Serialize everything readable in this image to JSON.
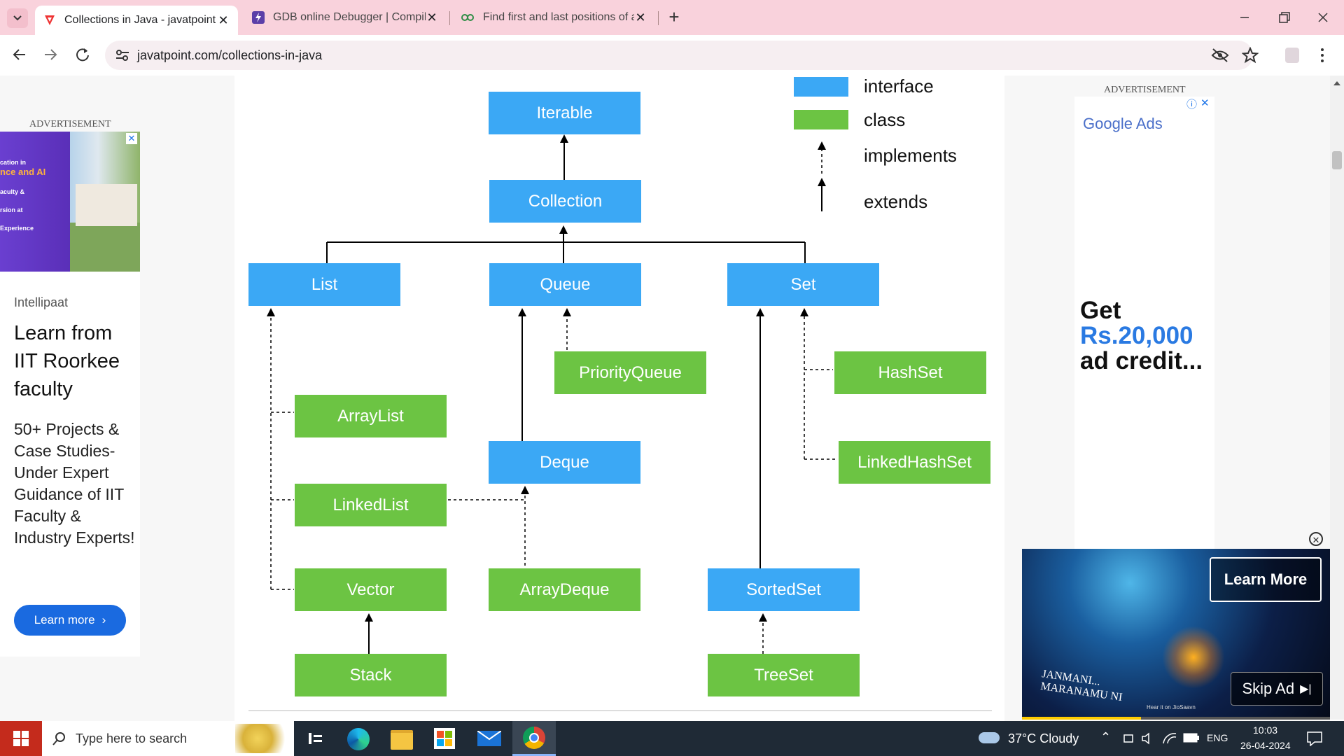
{
  "browser": {
    "tabs": [
      {
        "title": "Collections in Java - javatpoint",
        "icon": "javatpoint-favicon",
        "active": true
      },
      {
        "title": "GDB online Debugger | Compile",
        "icon": "gdb-favicon",
        "active": false
      },
      {
        "title": "Find first and last positions of a",
        "icon": "gfg-favicon",
        "active": false
      }
    ],
    "new_tab_symbol": "+",
    "address": "javatpoint.com/collections-in-java"
  },
  "left_ad": {
    "label": "ADVERTISEMENT",
    "banner_lines": [
      "cation in",
      "nce and AI",
      "aculty &",
      "rsion at",
      "Experience"
    ],
    "brand": "Intellipaat",
    "headline": "Learn from IIT Roorkee faculty",
    "body": "50+ Projects & Case Studies- Under Expert Guidance of IIT Faculty & Industry Experts!",
    "cta": "Learn more"
  },
  "diagram": {
    "legend": {
      "interface": "interface",
      "class": "class",
      "implements": "implements",
      "extends": "extends"
    },
    "nodes": {
      "iterable": "Iterable",
      "collection": "Collection",
      "list": "List",
      "queue": "Queue",
      "set": "Set",
      "priorityqueue": "PriorityQueue",
      "hashset": "HashSet",
      "arraylist": "ArrayList",
      "deque": "Deque",
      "linkedhashset": "LinkedHashSet",
      "linkedlist": "LinkedList",
      "vector": "Vector",
      "arraydeque": "ArrayDeque",
      "sortedset": "SortedSet",
      "stack": "Stack",
      "treeset": "TreeSet"
    },
    "colors": {
      "interface": "#3ba8f5",
      "class": "#6cc443"
    }
  },
  "right_ad": {
    "label": "ADVERTISEMENT",
    "google": "Google Ads",
    "get": "Get",
    "amount": "Rs.20,000",
    "tail": "ad credit..."
  },
  "video_ad": {
    "learn_more": "Learn More",
    "skip": "Skip Ad",
    "overlay_line1": "JANMANI...",
    "overlay_line2": "MARANAMU NI",
    "small_text": "Hear it on JioSaavn"
  },
  "taskbar": {
    "search_placeholder": "Type here to search",
    "weather": "37°C  Cloudy",
    "lang": "ENG",
    "time": "10:03",
    "date": "26-04-2024"
  }
}
